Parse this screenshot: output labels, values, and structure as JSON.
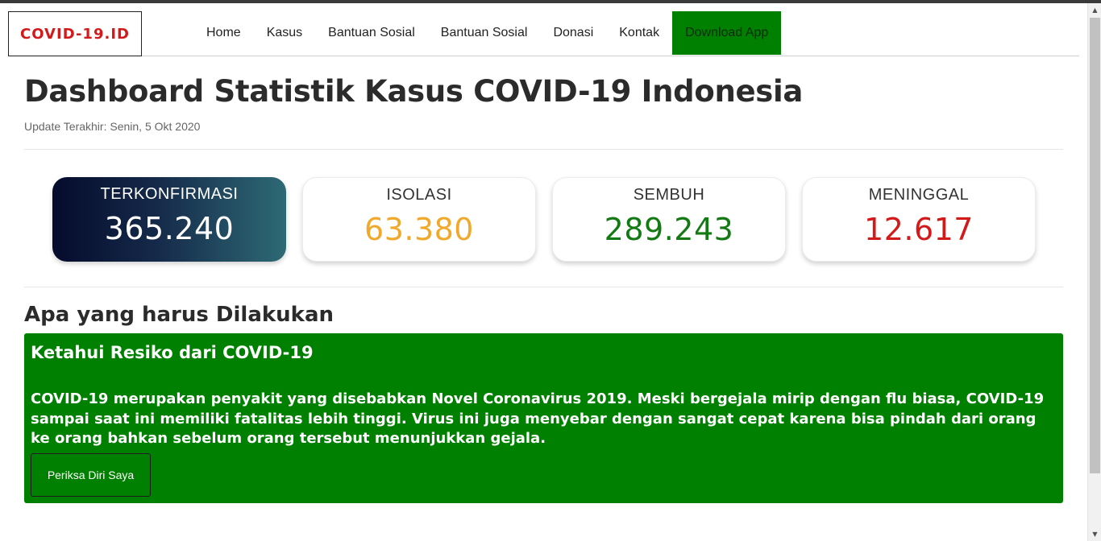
{
  "brand": "COVID-19.ID",
  "nav": {
    "items": [
      "Home",
      "Kasus",
      "Bantuan Sosial",
      "Bantuan Sosial",
      "Donasi",
      "Kontak"
    ],
    "download_label": "Download App"
  },
  "header": {
    "title": "Dashboard Statistik Kasus COVID-19 Indonesia",
    "update": "Update Terakhir: Senin, 5 Okt 2020"
  },
  "stats": {
    "confirmed": {
      "label": "TERKONFIRMASI",
      "value": "365.240"
    },
    "isolation": {
      "label": "ISOLASI",
      "value": "63.380"
    },
    "recovered": {
      "label": "SEMBUH",
      "value": "289.243"
    },
    "deaths": {
      "label": "MENINGGAL",
      "value": "12.617"
    }
  },
  "section": {
    "title": "Apa yang harus Dilakukan",
    "box_title": "Ketahui Resiko dari COVID-19",
    "box_text": "COVID-19 merupakan penyakit yang disebabkan Novel Coronavirus 2019. Meski bergejala mirip dengan flu biasa, COVID-19 sampai saat ini memiliki fatalitas lebih tinggi. Virus ini juga menyebar dengan sangat cepat karena bisa pindah dari orang ke orang bahkan sebelum orang tersebut menunjukkan gejala.",
    "button_label": "Periksa Diri Saya"
  },
  "colors": {
    "brand_red": "#d21a1a",
    "accent_green": "#008000",
    "isolation_orange": "#f0a92d",
    "recovered_green": "#137a13"
  }
}
